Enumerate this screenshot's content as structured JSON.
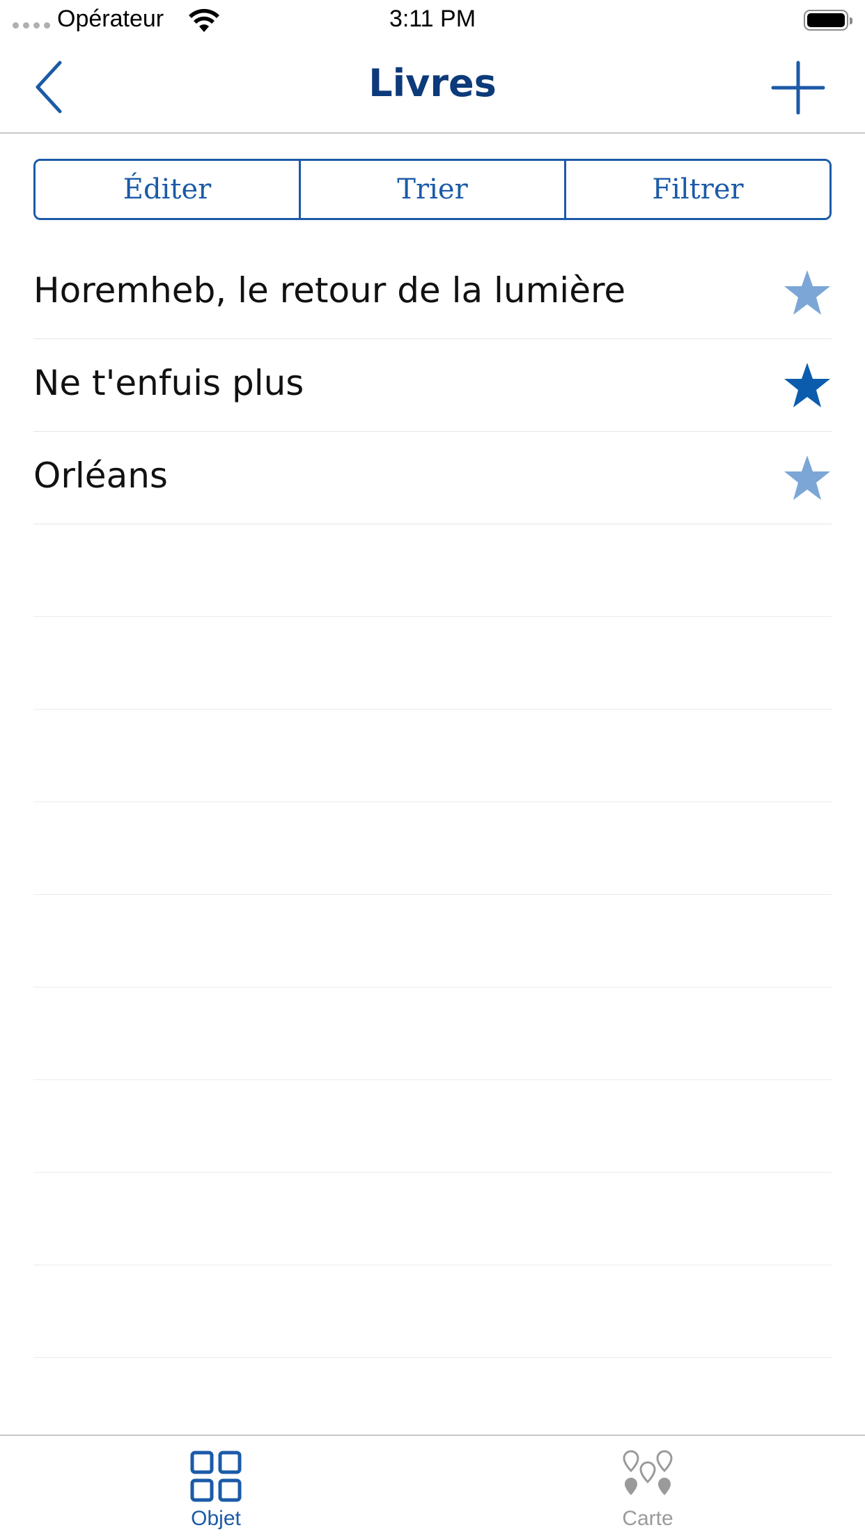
{
  "status_bar": {
    "carrier": "Opérateur",
    "time": "3:11 PM",
    "battery_level": 1.0
  },
  "nav": {
    "title": "Livres",
    "back_icon": "chevron-left-icon",
    "add_icon": "plus-icon"
  },
  "segments": [
    {
      "label": "Éditer"
    },
    {
      "label": "Trier"
    },
    {
      "label": "Filtrer"
    }
  ],
  "books": [
    {
      "title": "Horemheb, le retour de la lumière",
      "favorite": false
    },
    {
      "title": "Ne t'enfuis plus",
      "favorite": true
    },
    {
      "title": "Orléans",
      "favorite": false
    }
  ],
  "tabs": [
    {
      "label": "Objet",
      "icon": "grid-icon",
      "selected": true
    },
    {
      "label": "Carte",
      "icon": "map-pins-icon",
      "selected": false
    }
  ],
  "colors": {
    "accent": "#1b5aa7",
    "title": "#0c3a7a",
    "star_active": "#0b5cad",
    "star_inactive": "#7ba6d6",
    "tab_inactive": "#9a9a9a"
  }
}
